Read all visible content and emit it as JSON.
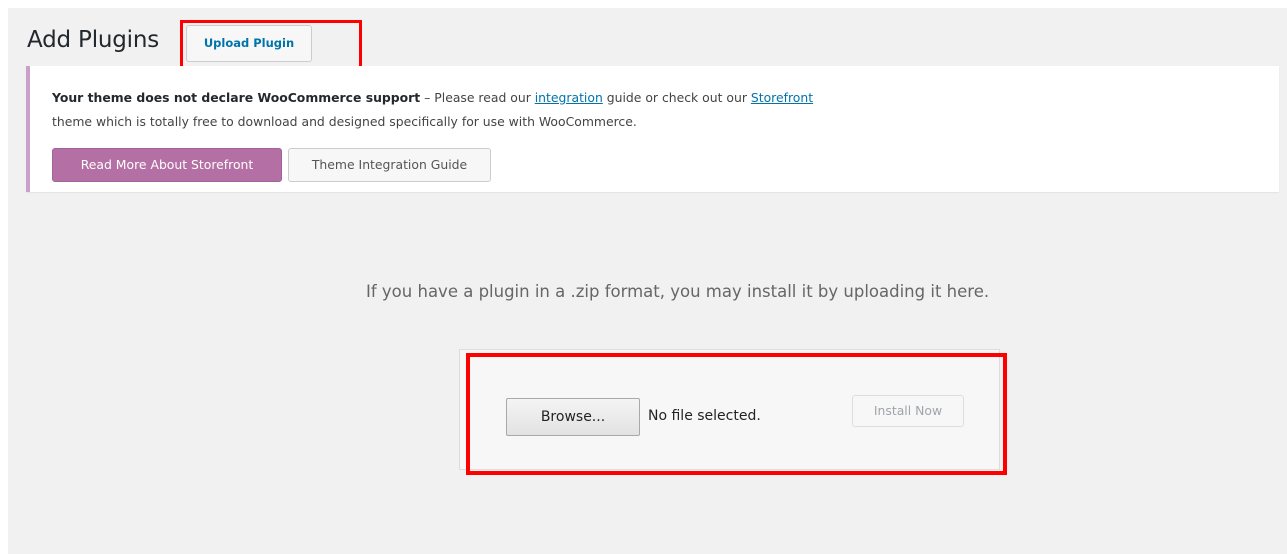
{
  "header": {
    "title": "Add Plugins",
    "upload_button_label": "Upload Plugin"
  },
  "notice": {
    "bold_text": "Your theme does not declare WooCommerce support",
    "text_part1": " – Please read our ",
    "integration_link": "integration",
    "text_part2": " guide or check out our ",
    "storefront_link": "Storefront",
    "text_line2": "theme which is totally free to download and designed specifically for use with WooCommerce.",
    "primary_button_label": "Read More About Storefront",
    "secondary_button_label": "Theme Integration Guide"
  },
  "upload": {
    "help_text": "If you have a plugin in a .zip format, you may install it by uploading it here.",
    "browse_label": "Browse...",
    "file_status": "No file selected.",
    "install_label": "Install Now"
  },
  "colors": {
    "highlight": "#ff0000",
    "woocommerce_purple": "#b46fa5",
    "link_blue": "#0073aa"
  }
}
